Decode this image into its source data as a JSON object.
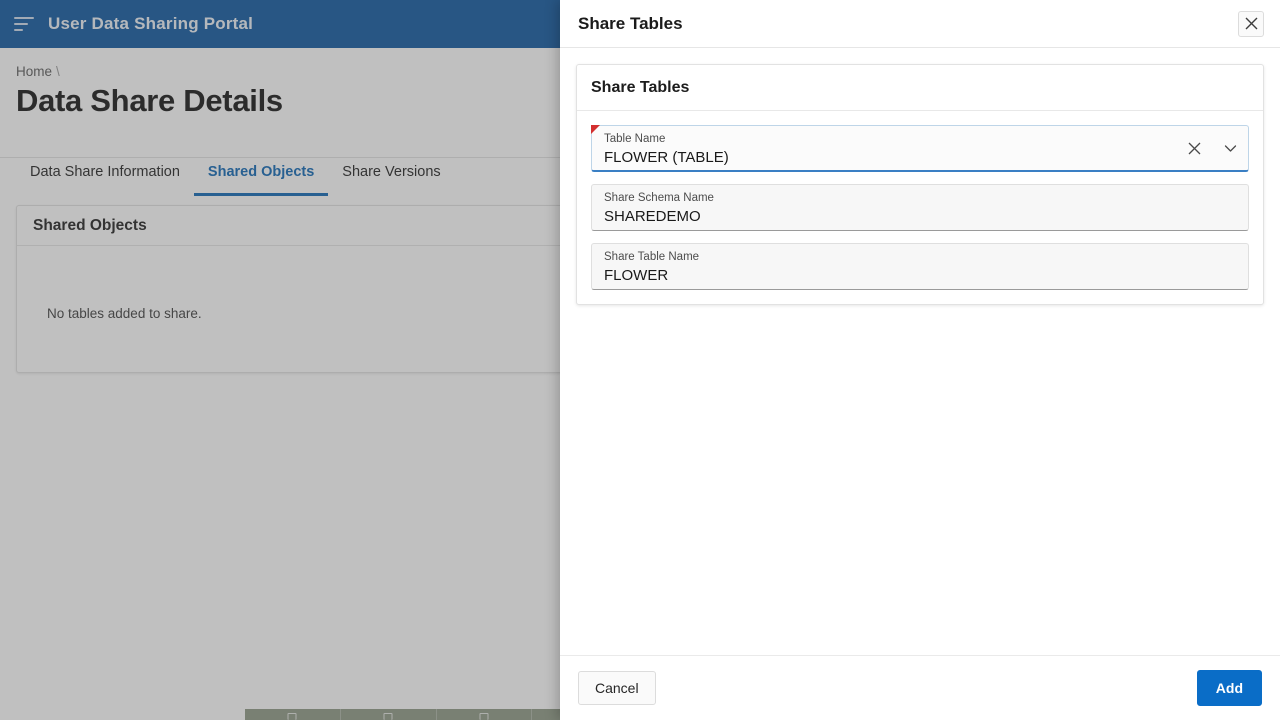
{
  "appbar": {
    "menu_icon": "hamburger-menu-icon",
    "title": "User Data Sharing Portal",
    "background": "#0a549e"
  },
  "breadcrumb": {
    "home": "Home",
    "separator": "\\"
  },
  "page": {
    "title": "Data Share Details"
  },
  "tabs": [
    {
      "label": "Data Share Information",
      "active": false
    },
    {
      "label": "Shared Objects",
      "active": true
    },
    {
      "label": "Share Versions",
      "active": false
    }
  ],
  "shared_objects_panel": {
    "title": "Shared Objects",
    "empty_message": "No tables added to share."
  },
  "modal": {
    "title": "Share Tables",
    "close_icon": "close-icon",
    "card_title": "Share Tables",
    "fields": [
      {
        "label": "Table Name",
        "value": "FLOWER (TABLE)",
        "required": true,
        "focused": true,
        "clear_icon": "close-icon",
        "dropdown_icon": "chevron-down-icon"
      },
      {
        "label": "Share Schema Name",
        "value": "SHAREDEMO",
        "required": false,
        "focused": false
      },
      {
        "label": "Share Table Name",
        "value": "FLOWER",
        "required": false,
        "focused": false
      }
    ],
    "cancel_label": "Cancel",
    "add_label": "Add",
    "accent_color": "#0a6dc7"
  }
}
